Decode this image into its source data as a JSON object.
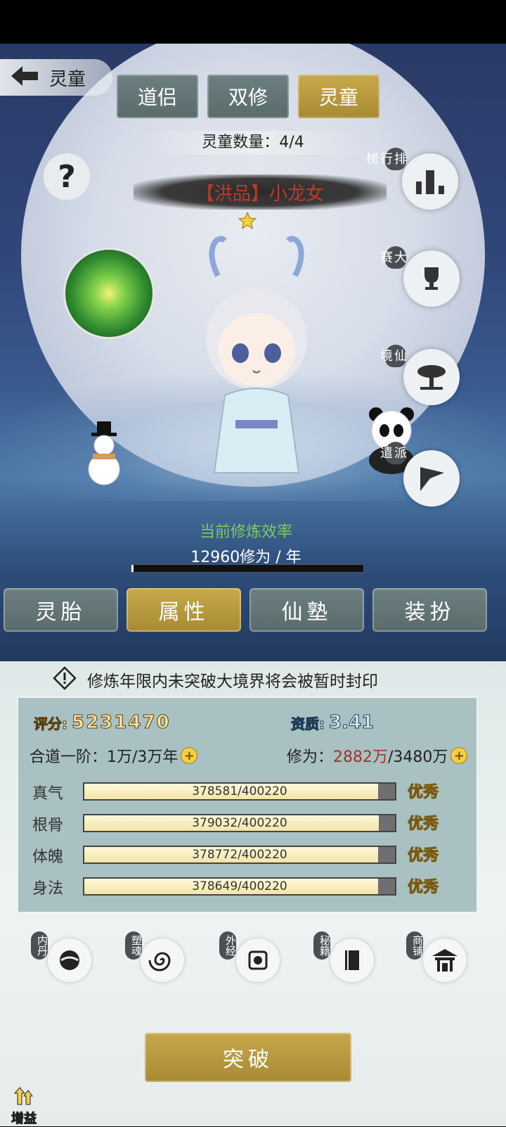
{
  "header": {
    "back_title": "灵童"
  },
  "tabs": [
    {
      "label": "道侣"
    },
    {
      "label": "双修"
    },
    {
      "label": "灵童"
    }
  ],
  "child_count": "灵童数量：4/4",
  "character": {
    "quality_prefix": "【洪品】",
    "name": "小龙女",
    "stars": 1
  },
  "side_buttons": [
    {
      "label": "排行榜"
    },
    {
      "label": "大赛"
    },
    {
      "label": "仙境"
    },
    {
      "label": "派遣"
    }
  ],
  "efficiency": {
    "title": "当前修炼效率",
    "value": "12960修为 / 年",
    "progress": 0.01
  },
  "segments": [
    {
      "label": "灵胎"
    },
    {
      "label": "属性"
    },
    {
      "label": "仙塾"
    },
    {
      "label": "装扮"
    }
  ],
  "notice": "修炼年限内未突破大境界将会被暂时封印",
  "score": {
    "label": "评分:",
    "value": "5231470"
  },
  "aptitude": {
    "label": "资质:",
    "value": "3.41"
  },
  "realm": {
    "text": "合道一阶：1万/3万年"
  },
  "cultivation": {
    "label": "修为：",
    "current": "2882万",
    "total": "/3480万"
  },
  "stats": [
    {
      "name": "真气",
      "value": "378581/400220",
      "fraction": 0.946,
      "grade": "优秀"
    },
    {
      "name": "根骨",
      "value": "379032/400220",
      "fraction": 0.947,
      "grade": "优秀"
    },
    {
      "name": "体魄",
      "value": "378772/400220",
      "fraction": 0.946,
      "grade": "优秀"
    },
    {
      "name": "身法",
      "value": "378649/400220",
      "fraction": 0.946,
      "grade": "优秀"
    }
  ],
  "bottom_buttons": [
    {
      "label": "内丹"
    },
    {
      "label": "塑魂"
    },
    {
      "label": "外经"
    },
    {
      "label": "秘籍"
    },
    {
      "label": "商铺"
    }
  ],
  "breakthrough": "突破",
  "boost": "增益",
  "colors": {
    "gold": "#c8a94b",
    "grey_tab": "#6d7f80",
    "quality_red": "#c0392b",
    "cultivation_red": "#a0322a",
    "efficiency_green": "#7ecb5a"
  }
}
